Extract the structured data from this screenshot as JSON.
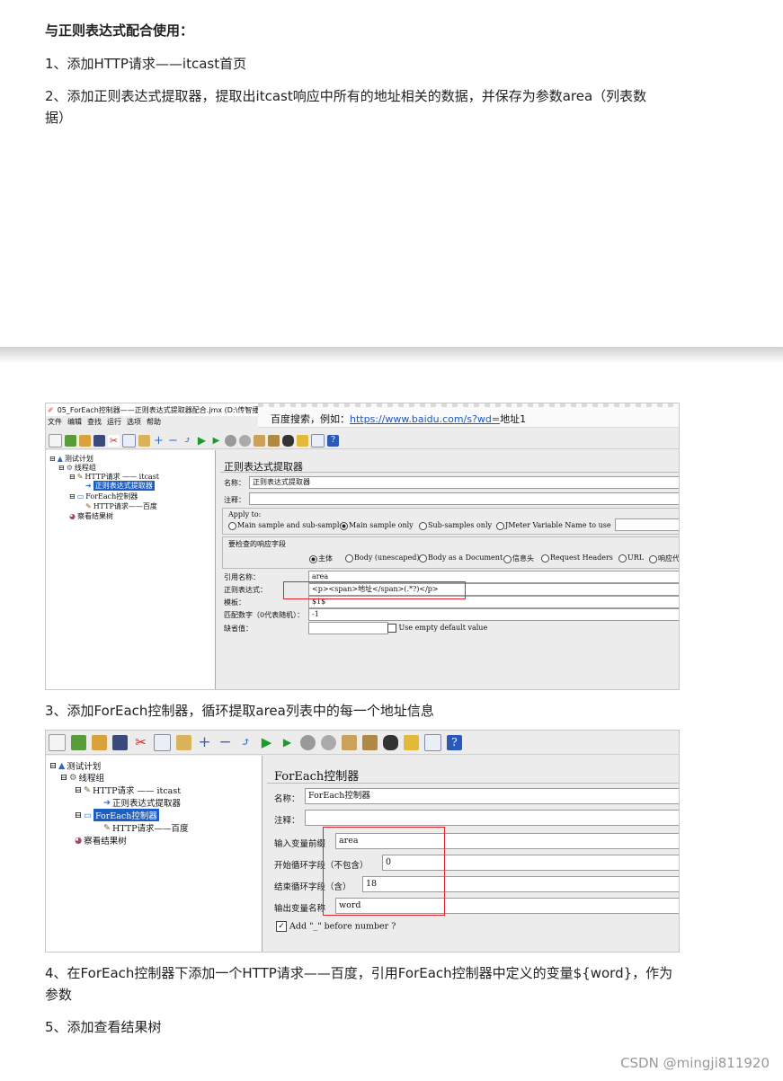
{
  "heading": "与正则表达式配合使用：",
  "steps": {
    "s1": "1、添加HTTP请求——itcast首页",
    "s2a": "2、添加正则表达式提取器，提取出itcast响应中所有的地址相关的数据，并保存为参数area（列表数",
    "s2b": "据）",
    "s3": "3、添加ForEach控制器，循环提取area列表中的每一个地址信息",
    "s4a": "4、在ForEach控制器下添加一个HTTP请求——百度，引用ForEach控制器中定义的变量${word}，作为",
    "s4b": "参数",
    "s5": "5、添加查看结果树"
  },
  "shot1": {
    "window_title": "05_ForEach控制器——正则表达式提取器配合.jmx (D:\\传智播",
    "menu": [
      "文件",
      "编辑",
      "查找",
      "运行",
      "选项",
      "帮助"
    ],
    "tooltip_prefix": "百度搜索，例如：",
    "tooltip_link": "https://www.baidu.com/s?wd=",
    "tooltip_suffix": "地址1",
    "tree": {
      "plan": "测试计划",
      "group": "线程组",
      "http1": "HTTP请求 —— itcast",
      "regex": "正则表达式提取器",
      "foreach": "ForEach控制器",
      "http2": "HTTP请求——百度",
      "results": "察看结果树"
    },
    "panel_title": "正则表达式提取器",
    "name_label": "名称：",
    "name_value": "正则表达式提取器",
    "comment_label": "注释：",
    "apply_to": "Apply to:",
    "apply_options": [
      "Main sample and sub-samples",
      "Main sample only",
      "Sub-samples only",
      "JMeter Variable Name to use"
    ],
    "response_field_label": "要检查的响应字段",
    "response_options": [
      "主体",
      "Body (unescaped)",
      "Body as a Document",
      "信息头",
      "Request Headers",
      "URL",
      "响应代"
    ],
    "ref_label": "引用名称：",
    "ref_value": "area",
    "regex_label": "正则表达式：",
    "regex_value": "<p><span>地址</span>(.*?)</p>",
    "template_label": "模板：",
    "template_value": "$1$",
    "match_label": "匹配数字（0代表随机）：",
    "match_value": "-1",
    "default_label": "缺省值：",
    "default_check_label": "Use empty default value"
  },
  "shot2": {
    "tree": {
      "plan": "测试计划",
      "group": "线程组",
      "http1": "HTTP请求 —— itcast",
      "regex": "正则表达式提取器",
      "foreach": "ForEach控制器",
      "http2": "HTTP请求——百度",
      "results": "察看结果树"
    },
    "panel_title": "ForEach控制器",
    "name_label": "名称：",
    "name_value": "ForEach控制器",
    "comment_label": "注释：",
    "input_prefix_label": "输入变量前缀",
    "input_prefix_value": "area",
    "start_label": "开始循环字段（不包含）",
    "start_value": "0",
    "end_label": "结束循环字段（含）",
    "end_value": "18",
    "output_label": "输出变量名称",
    "output_value": "word",
    "add_underscore_label": "Add \"_\" before number ?"
  },
  "footer": "CSDN @mingji811920",
  "colors": {
    "accent": "#e0232a",
    "selection": "#1b5fc4",
    "link": "#1a57c9"
  }
}
